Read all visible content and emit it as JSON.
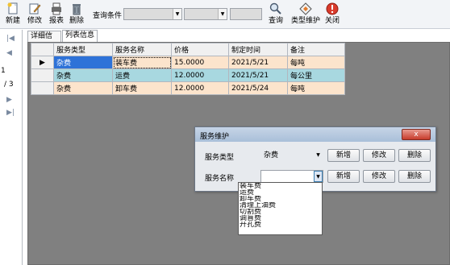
{
  "toolbar": {
    "buttons": [
      {
        "label": "新建",
        "icon": "new-icon"
      },
      {
        "label": "修改",
        "icon": "edit-icon"
      },
      {
        "label": "报表",
        "icon": "report-icon"
      },
      {
        "label": "删除",
        "icon": "delete-icon"
      }
    ],
    "query_label": "查询条件",
    "right_buttons": [
      {
        "label": "查询",
        "icon": "search-icon"
      },
      {
        "label": "类型维护",
        "icon": "type-maintenance-icon"
      },
      {
        "label": "关闭",
        "icon": "close-icon"
      }
    ]
  },
  "nav": {
    "first": "|◀",
    "prev": "◀",
    "page_value": "1",
    "page_total": "/ 3",
    "next": "▶",
    "last": "▶|"
  },
  "tabs": [
    {
      "label": "详细信息",
      "active": false
    },
    {
      "label": "列表信息",
      "active": true
    }
  ],
  "grid": {
    "columns": [
      "服务类型",
      "服务名称",
      "价格",
      "制定时间",
      "备注"
    ],
    "rows": [
      [
        "杂费",
        "装车费",
        "15.0000",
        "2021/5/21",
        "每吨"
      ],
      [
        "杂费",
        "运费",
        "12.0000",
        "2021/5/21",
        "每公里"
      ],
      [
        "杂费",
        "卸车费",
        "12.0000",
        "2021/5/24",
        "每吨"
      ]
    ],
    "current_marker": "▶"
  },
  "dialog": {
    "title": "服务维护",
    "close_glyph": "x",
    "type_label": "服务类型",
    "type_value": "杂费",
    "name_label": "服务名称",
    "name_value": "",
    "buttons": {
      "add": "新增",
      "edit": "修改",
      "delete": "删除"
    },
    "name_options": [
      "装车费",
      "运费",
      "卸车费",
      "清理上油费",
      "切割费",
      "调盲费",
      "开孔费"
    ]
  },
  "colors": {
    "row_even": "#fce4cc",
    "row_alt": "#a8d8e0",
    "selected_cell": "#2e72d8",
    "grid_background": "#808080"
  }
}
